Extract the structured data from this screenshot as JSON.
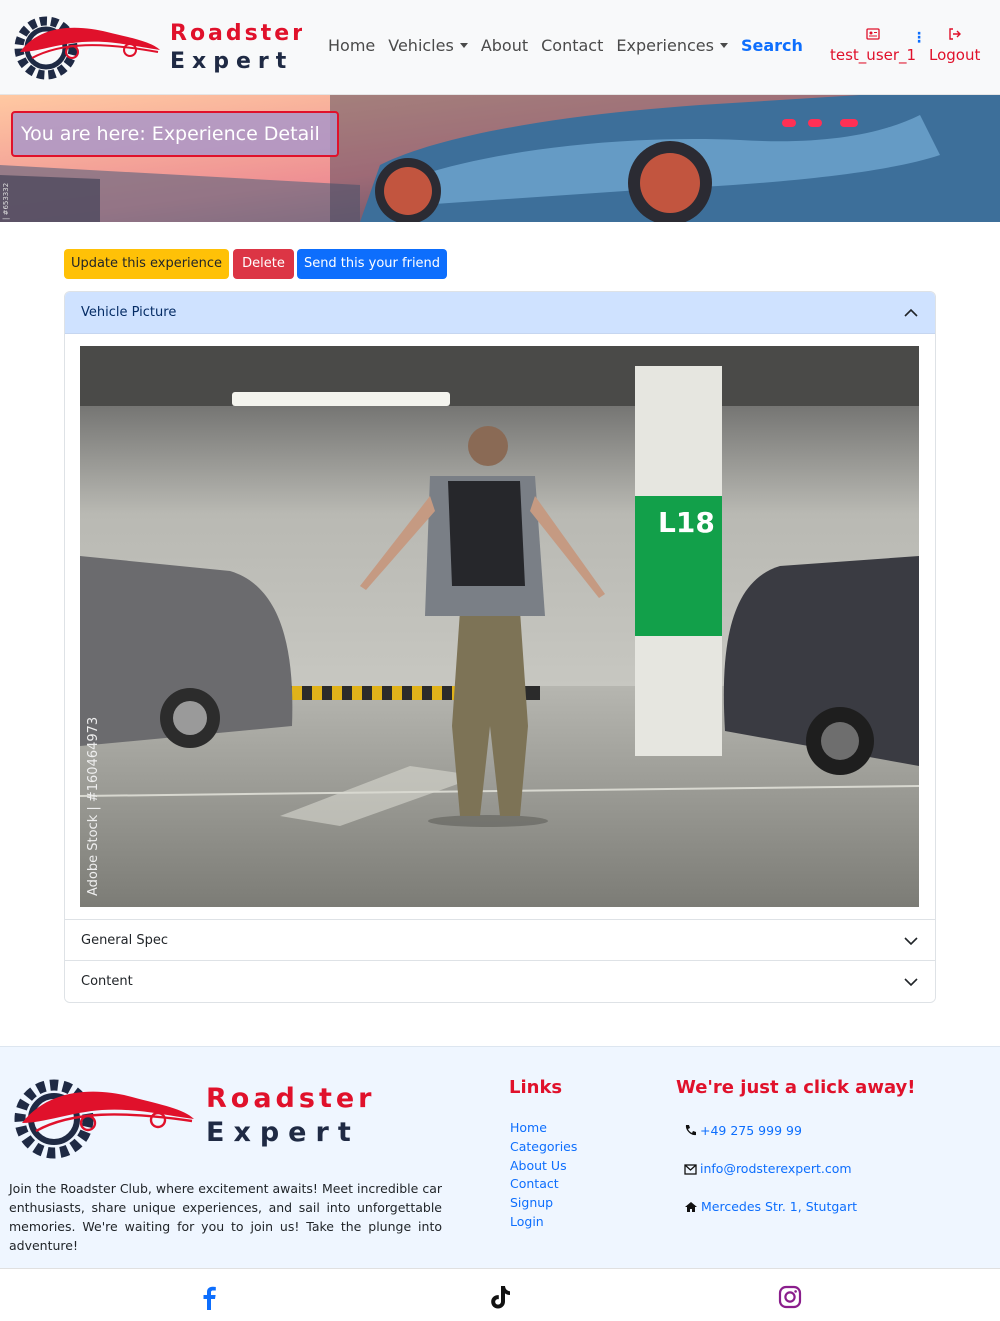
{
  "header": {
    "logo_line1": "Roadster",
    "logo_line2": "Expert",
    "nav": [
      "Home",
      "Vehicles",
      "About",
      "Contact",
      "Experiences",
      "Search"
    ],
    "user_label": "test_user_1",
    "logout_label": "Logout"
  },
  "banner": {
    "breadcrumb": "You are here: Experience Detail",
    "stock_id": "| #653332"
  },
  "actions": {
    "update_label": "Update this experience",
    "delete_label": "Delete",
    "send_label": "Send this your friend"
  },
  "accordion": {
    "picture_label": "Vehicle Picture",
    "general_label": "General Spec",
    "content_label": "Content"
  },
  "photo": {
    "watermark": "Adobe Stock | #160464973",
    "sign": "L18"
  },
  "footer": {
    "logo_line1": "Roadster",
    "logo_line2": "Expert",
    "about": "Join the Roadster Club, where excitement awaits! Meet incredible car enthusiasts, share unique experiences, and sail into unforgettable memories. We're waiting for you to join us! Take the plunge into adventure!",
    "links_title": "Links",
    "links": [
      "Home",
      "Categories",
      "About Us",
      "Contact",
      "Signup",
      "Login"
    ],
    "contact_title": "We're just a click away!",
    "phone": "+49 275 999 99",
    "email": "info@rodsterexpert.com",
    "address": "Mercedes Str. 1, Stutgart"
  },
  "colors": {
    "brand_red": "#e0112b",
    "link_blue": "#0d6efd",
    "warning": "#ffc107",
    "danger": "#dc3545",
    "accordion_active": "#cfe2ff"
  },
  "social": [
    "facebook-icon",
    "tiktok-icon",
    "instagram-icon"
  ]
}
